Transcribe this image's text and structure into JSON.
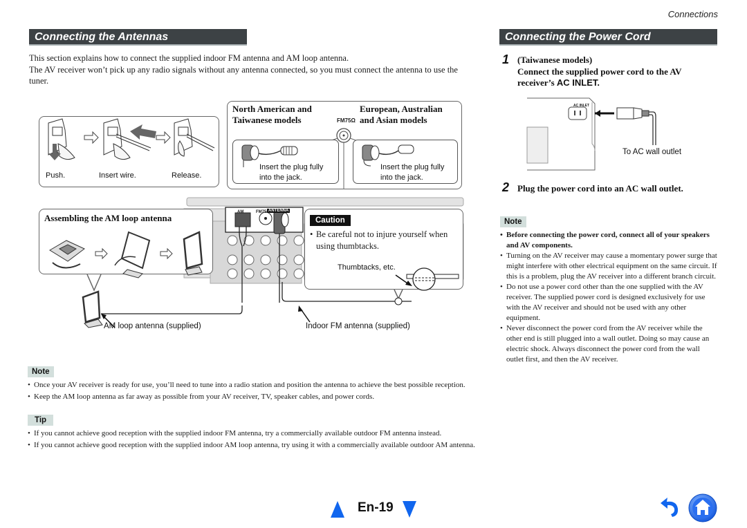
{
  "running_head": "Connections",
  "left": {
    "title": "Connecting the Antennas",
    "intro": [
      "This section explains how to connect the supplied indoor FM antenna and AM loop antenna.",
      "The AV receiver won’t pick up any radio signals without any antenna connected, so you must connect the antenna to use the tuner."
    ],
    "am_steps": {
      "push": "Push.",
      "insert": "Insert wire.",
      "release": "Release."
    },
    "fm_models": {
      "north_american": "North American and\nTaiwanese models",
      "european": "European, Australian\nand Asian models",
      "jack_label": "FM75Ω",
      "instruction_left": "Insert the plug fully\ninto the jack.",
      "instruction_right": "Insert the plug fully\ninto the jack."
    },
    "am_loop": {
      "heading": "Assembling the AM loop antenna"
    },
    "receiver_labels": {
      "am": "AM",
      "fm": "FM75Ω",
      "antenna": "ANTENNA"
    },
    "caution": {
      "badge": "Caution",
      "text": "Be careful not to injure yourself when using thumbtacks.",
      "thumbtacks_label": "Thumbtacks, etc."
    },
    "captions": {
      "am_antenna": "AM loop antenna (supplied)",
      "fm_antenna": "Indoor FM antenna (supplied)"
    },
    "note": {
      "badge": "Note",
      "items": [
        "Once your AV receiver is ready for use, you’ll need to tune into a radio station and position the antenna to achieve the best possible reception.",
        "Keep the AM loop antenna as far away as possible from your AV receiver, TV, speaker cables, and power cords."
      ]
    },
    "tip": {
      "badge": "Tip",
      "items": [
        "If you cannot achieve good reception with the supplied indoor FM antenna, try a commercially available outdoor FM antenna instead.",
        "If you cannot achieve good reception with the supplied indoor AM loop antenna, try using it with a commercially available outdoor AM antenna."
      ]
    }
  },
  "right": {
    "title": "Connecting the Power Cord",
    "step1": {
      "number": "1",
      "line1": "(Taiwanese models)",
      "line2": "Connect the supplied power cord to the AV receiver’s ",
      "line2_emph": "AC INLET."
    },
    "ac_inlet_label": "AC INLET",
    "wall_outlet_label": "To AC wall outlet",
    "step2": {
      "number": "2",
      "text": "Plug the power cord into an AC wall outlet."
    },
    "note": {
      "badge": "Note",
      "items": [
        {
          "text": "Before connecting the power cord, connect all of your speakers and AV components.",
          "bold": true
        },
        {
          "text": "Turning on the AV receiver may cause a momentary power surge that might interfere with other electrical equipment on the same circuit. If this is a problem, plug the AV receiver into a different branch circuit.",
          "bold": false
        },
        {
          "text": "Do not use a power cord other than the one supplied with the AV receiver. The supplied power cord is designed exclusively for use with the AV receiver and should not be used with any other equipment.",
          "bold": false
        },
        {
          "text": "Never disconnect the power cord from the AV receiver while the other end is still plugged into a wall outlet. Doing so may cause an electric shock. Always disconnect the power cord from the wall outlet first, and then the AV receiver.",
          "bold": false
        }
      ]
    }
  },
  "footer": {
    "page_label": "En-19",
    "prev_icon": "triangle-up-icon",
    "next_icon": "triangle-down-icon",
    "back_icon": "undo-arrow-icon",
    "home_icon": "home-icon",
    "accent_color": "#1166ee"
  }
}
